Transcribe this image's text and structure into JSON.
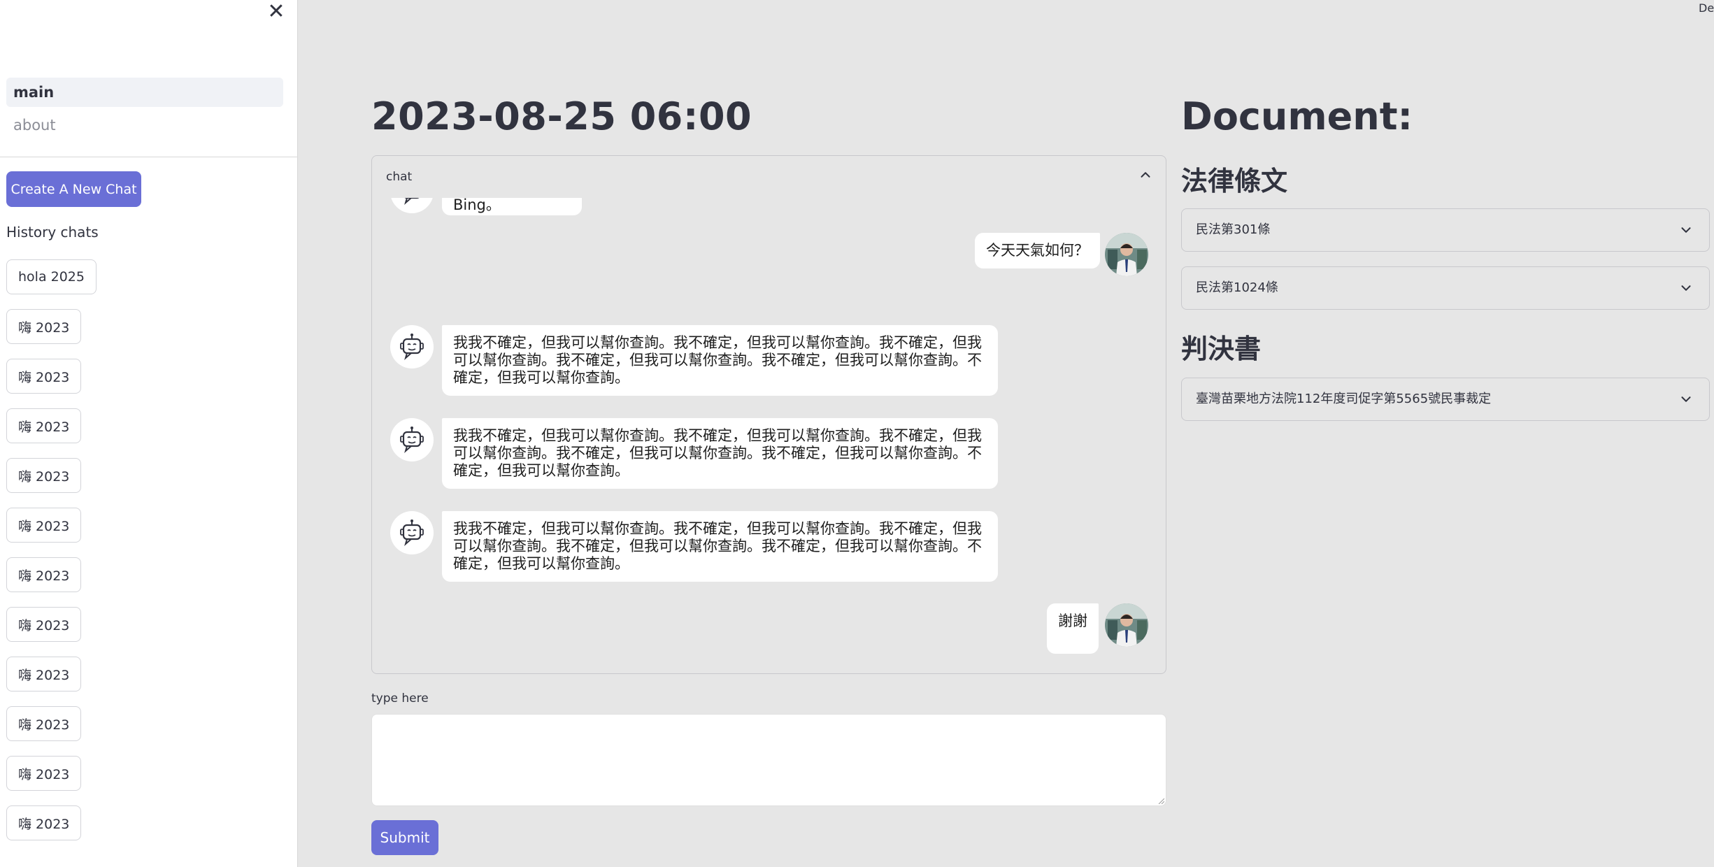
{
  "sidebar": {
    "close_icon": "close-icon",
    "nav": [
      {
        "label": "main",
        "active": true
      },
      {
        "label": "about",
        "active": false
      }
    ],
    "new_chat_label": "Create A New Chat",
    "history_label": "History chats",
    "history": [
      "hola 2025",
      "嗨 2023",
      "嗨 2023",
      "嗨 2023",
      "嗨 2023",
      "嗨 2023",
      "嗨 2023",
      "嗨 2023",
      "嗨 2023",
      "嗨 2023",
      "嗨 2023",
      "嗨 2023"
    ]
  },
  "topbar": {
    "deploy_label": "Deploy"
  },
  "main": {
    "title": "2023-08-25 06:00",
    "chat": {
      "header": "chat",
      "messages": [
        {
          "role": "bot",
          "text": "你好，這是Bing。"
        },
        {
          "role": "user",
          "text": "今天天氣如何？"
        },
        {
          "role": "bot",
          "lines": [
            "我我不確定，但我可以幫你查詢。我不確定，但我可以幫你查詢。我不確定，但我",
            "可以幫你查詢。我不確定，但我可以幫你查詢。我不確定，但我可以幫你查詢。不",
            "確定，但我可以幫你查詢。"
          ]
        },
        {
          "role": "bot",
          "lines": [
            "我我不確定，但我可以幫你查詢。我不確定，但我可以幫你查詢。我不確定，但我",
            "可以幫你查詢。我不確定，但我可以幫你查詢。我不確定，但我可以幫你查詢。不",
            "確定，但我可以幫你查詢。"
          ]
        },
        {
          "role": "bot",
          "lines": [
            "我我不確定，但我可以幫你查詢。我不確定，但我可以幫你查詢。我不確定，但我",
            "可以幫你查詢。我不確定，但我可以幫你查詢。我不確定，但我可以幫你查詢。不",
            "確定，但我可以幫你查詢。"
          ]
        },
        {
          "role": "user",
          "text": "謝謝"
        }
      ]
    },
    "input_label": "type here",
    "input_value": "",
    "submit_label": "Submit"
  },
  "document": {
    "title": "Document:",
    "sections": [
      {
        "title": "法律條文",
        "items": [
          "民法第301條",
          "民法第1024條"
        ]
      },
      {
        "title": "判決書",
        "items": [
          "臺灣苗栗地方法院112年度司促字第5565號民事裁定"
        ]
      }
    ]
  },
  "colors": {
    "accent": "#6a6fd6",
    "background": "#e6e6e6",
    "sidebar": "#ffffff",
    "text": "#31333f"
  }
}
